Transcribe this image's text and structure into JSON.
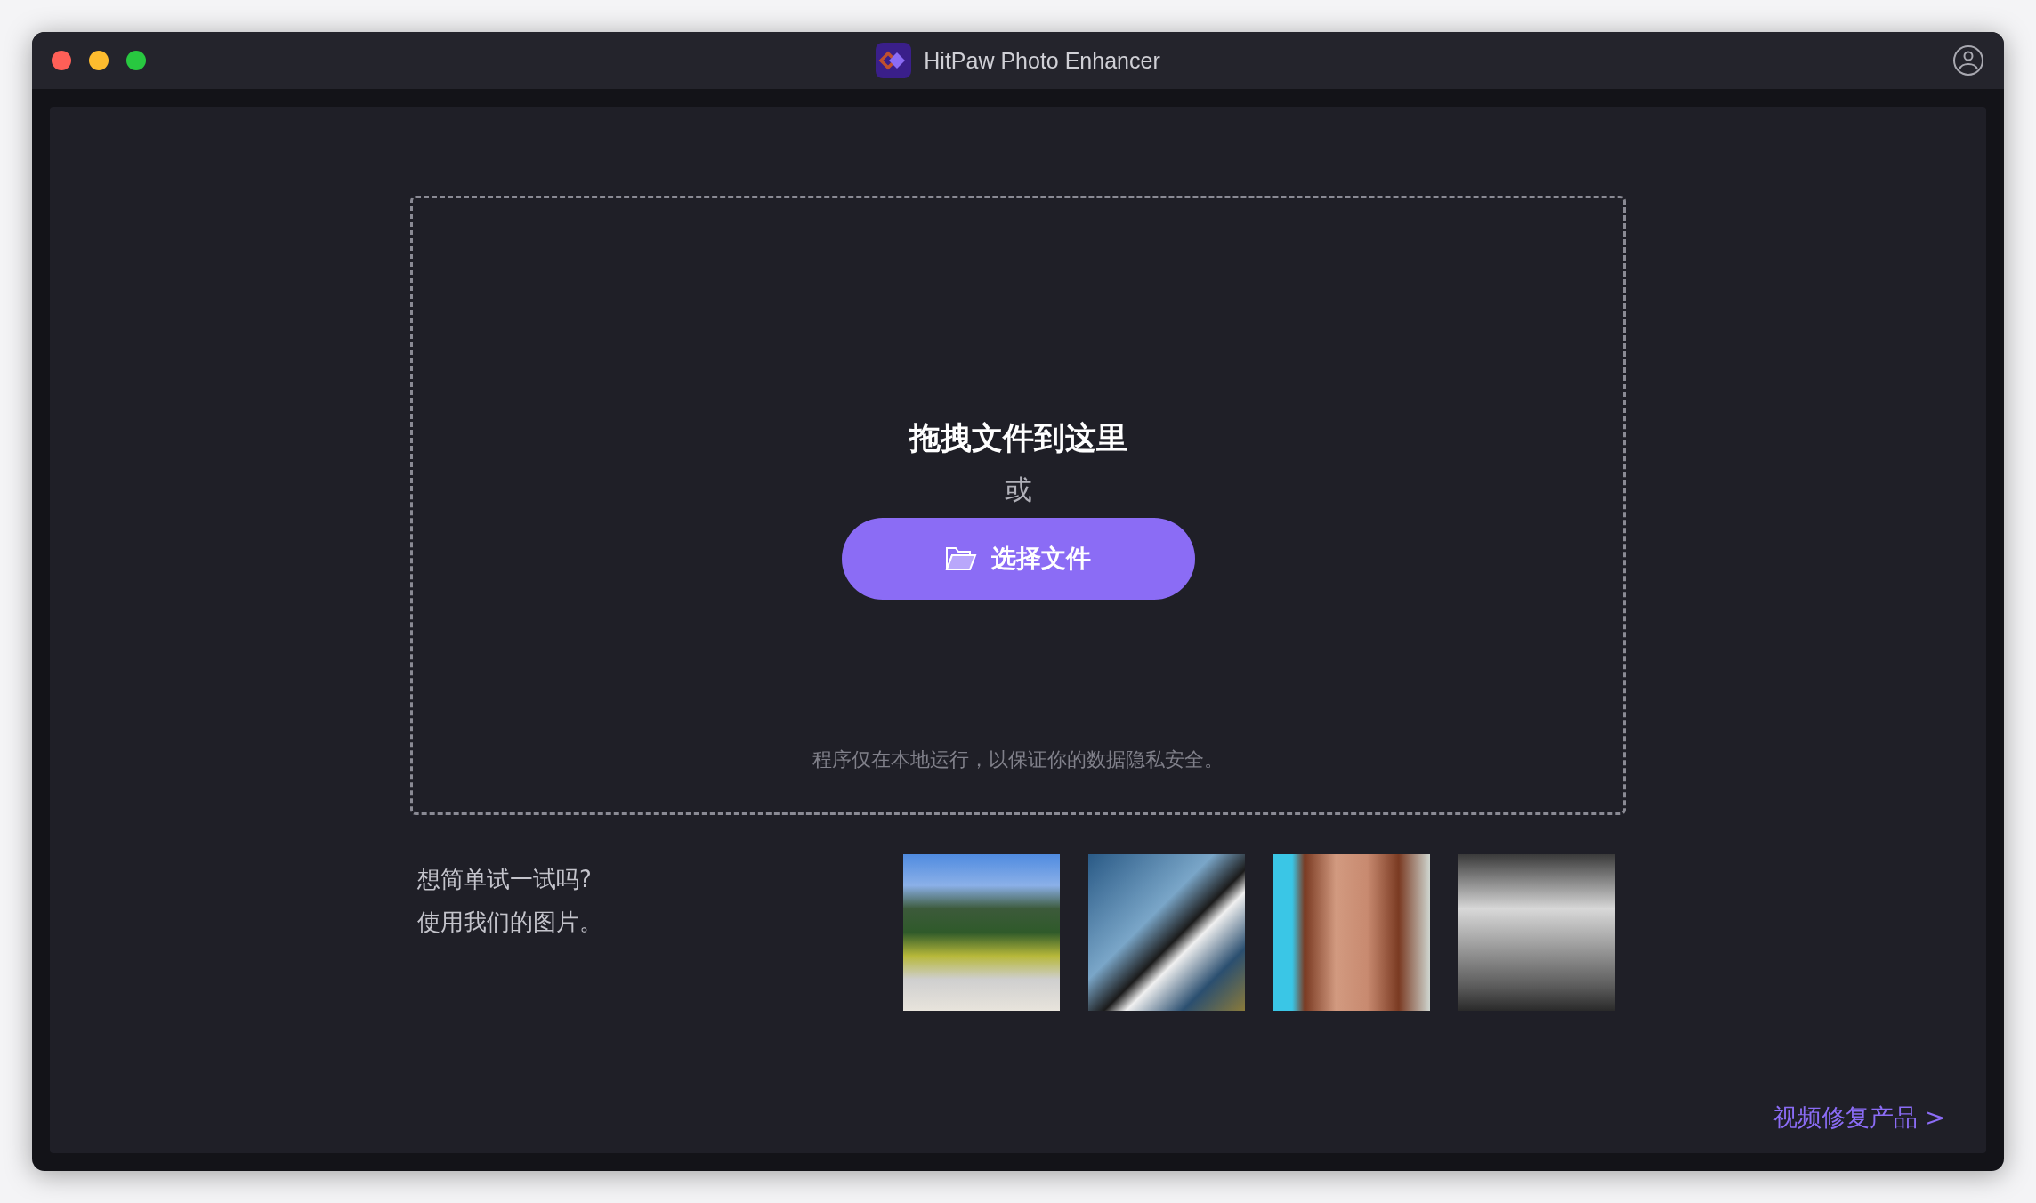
{
  "window": {
    "title": "HitPaw Photo Enhancer"
  },
  "drop_zone": {
    "heading": "拖拽文件到这里",
    "separator": "或",
    "button": "选择文件",
    "privacy_note": "程序仅在本地运行，以保证你的数据隐私安全。"
  },
  "samples": {
    "prompt": [
      "想简单试一试吗?",
      "使用我们的图片。"
    ]
  },
  "footer_link": "视频修复产品 >"
}
